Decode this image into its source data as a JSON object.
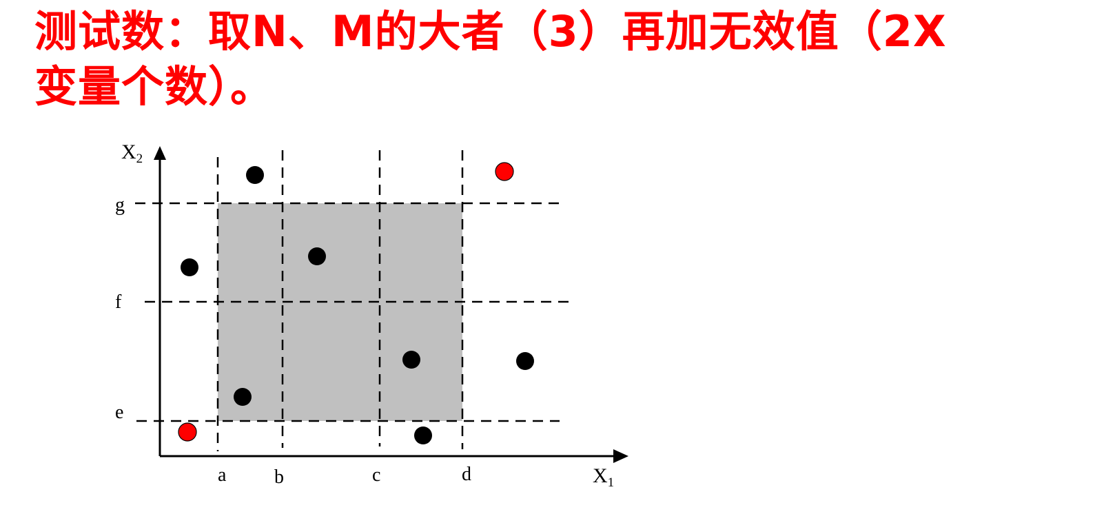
{
  "title": {
    "line1": "测试数：取N、M的大者（3）再加无效值（2X",
    "line2": "变量个数）。"
  },
  "diagram": {
    "axis_x": {
      "main": "X",
      "sub": "1"
    },
    "axis_y": {
      "main": "X",
      "sub": "2"
    },
    "x_boundaries": [
      "a",
      "b",
      "c",
      "d"
    ],
    "y_boundaries": [
      "e",
      "f",
      "g"
    ],
    "colors": {
      "valid_region": "#c0c0c0",
      "point": "#000000",
      "invalid_point": "#ff0000",
      "line": "#000000"
    }
  }
}
